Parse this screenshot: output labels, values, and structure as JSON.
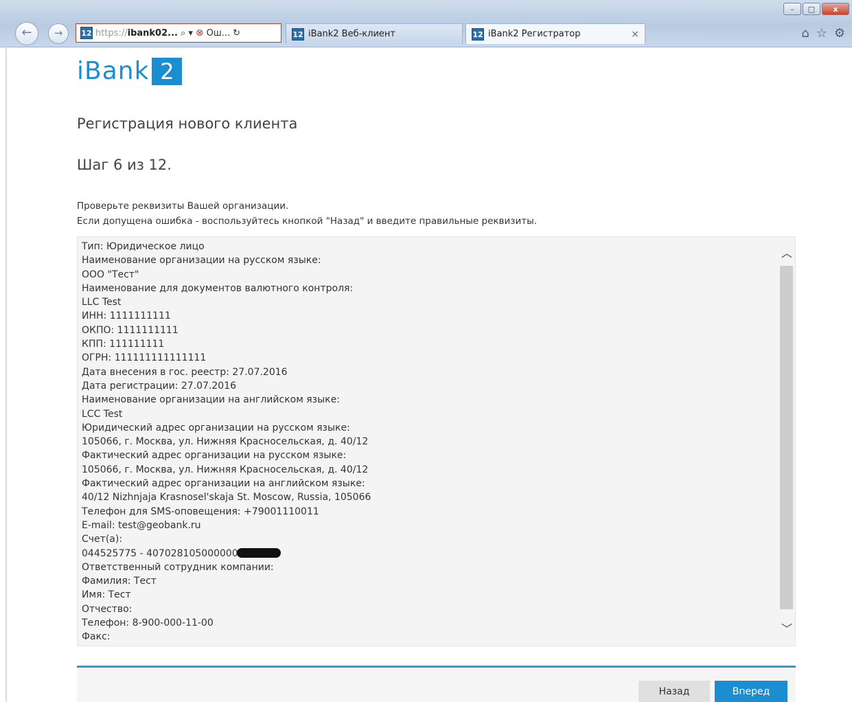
{
  "browser": {
    "back_glyph": "←",
    "forward_glyph": "→",
    "address": {
      "icon": "12",
      "protocol": "https://",
      "host": "ibank02...",
      "search_glyph": "⌕ ▾",
      "error_glyph": "⊗",
      "error_text": "Ош...",
      "refresh_glyph": "↻"
    },
    "tabs": [
      {
        "icon": "12",
        "label": "iBank2 Веб-клиент"
      },
      {
        "icon": "12",
        "label": "iBank2 Регистратор",
        "close": "×"
      }
    ],
    "window_controls": [
      "–",
      "□",
      "x"
    ],
    "toolbar_glyphs": {
      "home": "⌂",
      "favorites": "☆",
      "settings": "⚙"
    }
  },
  "logo": {
    "text": "iBank",
    "number": "2"
  },
  "page": {
    "title": "Регистрация нового клиента",
    "step": "Шаг 6 из 12.",
    "instructions": [
      "Проверьте реквизиты Вашей организации.",
      "Если допущена ошибка - воспользуйтесь кнопкой \"Назад\" и введите правильные реквизиты."
    ]
  },
  "details": {
    "lines_before_account": [
      "Тип: Юридическое лицо",
      "Наименование организации на русском языке:",
      "ООО \"Тест\"",
      "Наименование для документов валютного контроля:",
      "LLC Test",
      "ИНН: 1111111111",
      "ОКПО: 1111111111",
      "КПП: 111111111",
      "ОГРН: 111111111111111",
      "Дата внесения в гос. реестр: 27.07.2016",
      "Дата регистрации: 27.07.2016",
      "Наименование организации на английском языке:",
      "LCC Test",
      "Юридический адрес организации на русском языке:",
      "105066, г. Москва, ул. Нижняя Красносельская, д. 40/12",
      "Фактический адрес организации на русском языке:",
      "105066, г. Москва, ул. Нижняя Красносельская, д. 40/12",
      "Фактический адрес организации на английском языке:",
      "40/12 Nizhnjaja Krasnosel'skaja St. Moscow, Russia, 105066",
      "Телефон для SMS-оповещения: +79001110011",
      "E-mail: test@geobank.ru",
      "Счет(а):"
    ],
    "account_visible": "044525775 - 407028105000000",
    "lines_after_account": [
      "Ответственный сотрудник компании:",
      "Фамилия: Тест",
      "Имя: Тест",
      "Отчество:",
      "Телефон: 8-900-000-11-00",
      "Факс:"
    ],
    "scroll_up_glyph": "︿",
    "scroll_down_glyph": "﹀"
  },
  "buttons": {
    "back": "Назад",
    "next": "Вперед"
  },
  "colors": {
    "brand": "#1a8ed0"
  }
}
